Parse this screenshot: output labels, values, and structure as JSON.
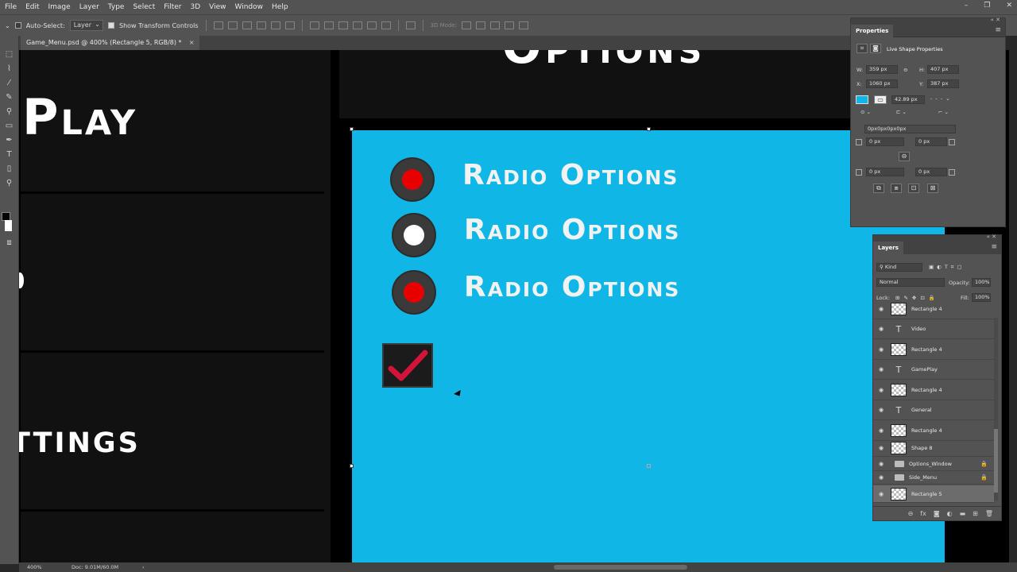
{
  "menubar": {
    "items": [
      "File",
      "Edit",
      "Image",
      "Layer",
      "Type",
      "Select",
      "Filter",
      "3D",
      "View",
      "Window",
      "Help"
    ]
  },
  "options_bar": {
    "auto_select_label": "Auto-Select:",
    "auto_select_value": "Layer",
    "transform_controls_label": "Show Transform Controls",
    "mode_3d_label": "3D Mode:"
  },
  "document": {
    "tab_title": "Game_Menu.psd @ 400% (Rectangle 5, RGB/8) *",
    "close_glyph": "×"
  },
  "canvas": {
    "side_menu": {
      "play_label": "Play",
      "settings_label": "ttings"
    },
    "options_title": "Options",
    "radio_options": [
      {
        "label": "Radio Options",
        "selected": true,
        "fill_color": "#e60000"
      },
      {
        "label": "Radio Options",
        "selected": false,
        "fill_color": "#ffffff"
      },
      {
        "label": "Radio Options",
        "selected": true,
        "fill_color": "#e60000"
      }
    ],
    "checkbox": {
      "checked": true,
      "check_color": "#d2143a"
    },
    "panel_color": "#10b7e6"
  },
  "properties_panel": {
    "title": "Properties",
    "section_title": "Live Shape Properties",
    "w_label": "W:",
    "w_value": "359 px",
    "h_label": "H:",
    "h_value": "407 px",
    "x_label": "X:",
    "x_value": "1060 px",
    "y_label": "Y:",
    "y_value": "387 px",
    "stroke_size": "42.89 px",
    "radius_string": "0px0px0px0px",
    "corner_tl": "0 px",
    "corner_tr": "0 px",
    "corner_bl": "0 px",
    "corner_br": "0 px",
    "fill_color": "#10b7e6"
  },
  "layers_panel": {
    "title": "Layers",
    "kind_label": "Kind",
    "blend_mode": "Normal",
    "opacity_label": "Opacity:",
    "opacity_value": "100%",
    "lock_label": "Lock:",
    "fill_label": "Fill:",
    "fill_value": "100%",
    "rows": [
      {
        "name": "Rectangle 4",
        "type": "shape",
        "selected": false,
        "locked": false
      },
      {
        "name": "Video",
        "type": "text",
        "selected": false,
        "locked": false
      },
      {
        "name": "Rectangle 4",
        "type": "shape",
        "selected": false,
        "locked": false
      },
      {
        "name": "GamePlay",
        "type": "text",
        "selected": false,
        "locked": false
      },
      {
        "name": "Rectangle 4",
        "type": "shape",
        "selected": false,
        "locked": false
      },
      {
        "name": "General",
        "type": "text",
        "selected": false,
        "locked": false
      },
      {
        "name": "Rectangle 4",
        "type": "shape",
        "selected": false,
        "locked": false
      },
      {
        "name": "Shape 8",
        "type": "shape",
        "selected": false,
        "locked": false
      },
      {
        "name": "Options_Window",
        "type": "group",
        "selected": false,
        "locked": true
      },
      {
        "name": "Side_Menu",
        "type": "group",
        "selected": false,
        "locked": true
      },
      {
        "name": "Rectangle 5",
        "type": "shape",
        "selected": true,
        "locked": false
      }
    ]
  },
  "status_bar": {
    "zoom": "400%",
    "doc_size": "Doc: 9.01M/60.0M",
    "arrow": "›"
  }
}
